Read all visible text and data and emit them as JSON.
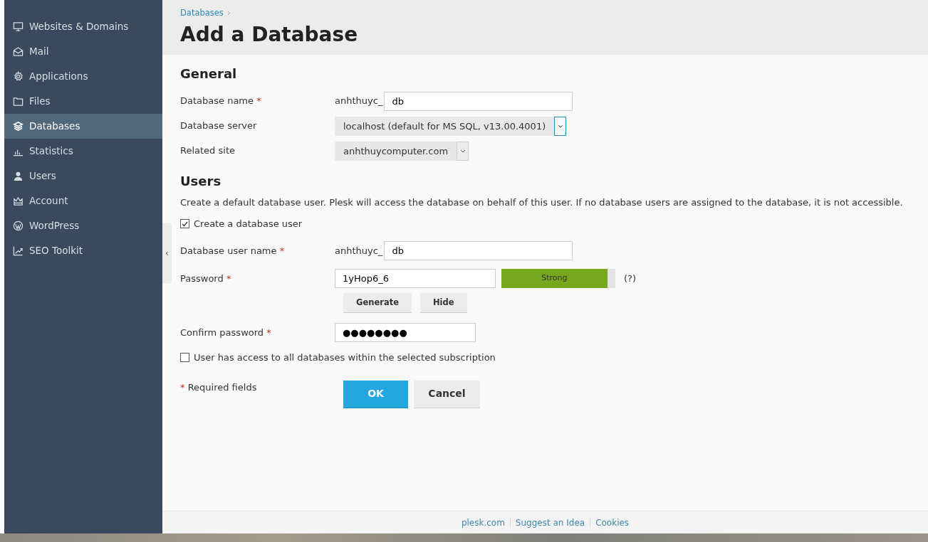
{
  "sidebar": {
    "items": [
      {
        "label": "Websites & Domains",
        "selected": false
      },
      {
        "label": "Mail",
        "selected": false
      },
      {
        "label": "Applications",
        "selected": false
      },
      {
        "label": "Files",
        "selected": false
      },
      {
        "label": "Databases",
        "selected": true
      },
      {
        "label": "Statistics",
        "selected": false
      },
      {
        "label": "Users",
        "selected": false
      },
      {
        "label": "Account",
        "selected": false
      },
      {
        "label": "WordPress",
        "selected": false
      },
      {
        "label": "SEO Toolkit",
        "selected": false
      }
    ]
  },
  "breadcrumb": "Databases",
  "breadcrumb_separator": "›",
  "title": "Add a Database",
  "general": {
    "heading": "General",
    "rows": [
      {
        "kind": "prefixed",
        "label": "Database name",
        "required": true,
        "prefix": "anhthuyc_",
        "value": "db"
      },
      {
        "kind": "select",
        "label": "Database server",
        "required": false,
        "value": "localhost (default for MS SQL, v13.00.4001)",
        "focused": true
      },
      {
        "kind": "select",
        "label": "Related site",
        "required": false,
        "value": "anhthuycomputer.com",
        "focused": false
      }
    ]
  },
  "users": {
    "heading": "Users",
    "description": "Create a default database user. Plesk will access the database on behalf of this user. If no database users are assigned to the database, it is not accessible.",
    "create_user": {
      "label": "Create a database user",
      "checked": true
    },
    "user_name": {
      "label": "Database user name",
      "required": true,
      "prefix": "anhthuyc_",
      "value": "db"
    },
    "password": {
      "label": "Password",
      "required": true,
      "value": "1yHop6_6",
      "strength": "Strong",
      "level": 0.93,
      "help": "(?)"
    },
    "password_buttons": [
      "Generate",
      "Hide"
    ],
    "confirm": {
      "label": "Confirm password",
      "required": true,
      "value": "●●●●●●●●"
    },
    "all_access": {
      "label": "User has access to all databases within the selected subscription",
      "checked": false
    }
  },
  "required_note": "Required fields",
  "required_mark": "*",
  "buttons": [
    {
      "label": "OK",
      "kind": "primary"
    },
    {
      "label": "Cancel",
      "kind": "secondary"
    }
  ],
  "collapse_handle": "‹",
  "footer_links": [
    "plesk.com",
    "Suggest an Idea",
    "Cookies"
  ]
}
